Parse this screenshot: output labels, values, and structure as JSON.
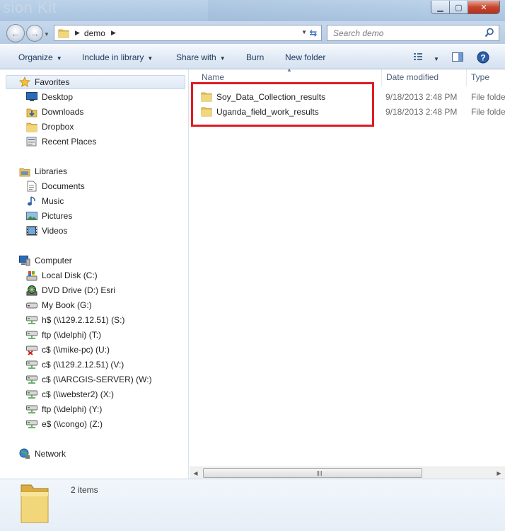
{
  "window": {
    "title_ghost": "sion Kit"
  },
  "address": {
    "path": [
      "demo"
    ],
    "search_placeholder": "Search demo"
  },
  "toolbar": {
    "organize": "Organize",
    "include_in_library": "Include in library",
    "share_with": "Share with",
    "burn": "Burn",
    "new_folder": "New folder"
  },
  "nav": {
    "favorites": "Favorites",
    "desktop": "Desktop",
    "downloads": "Downloads",
    "dropbox": "Dropbox",
    "recent_places": "Recent Places",
    "libraries": "Libraries",
    "documents": "Documents",
    "music": "Music",
    "pictures": "Pictures",
    "videos": "Videos",
    "computer": "Computer",
    "drives": [
      "Local Disk (C:)",
      "DVD Drive (D:) Esri",
      "My Book (G:)",
      "h$ (\\\\129.2.12.51) (S:)",
      "ftp (\\\\delphi) (T:)",
      "c$ (\\\\mike-pc) (U:)",
      "c$ (\\\\129.2.12.51) (V:)",
      "c$ (\\\\ARCGIS-SERVER) (W:)",
      "c$ (\\\\webster2) (X:)",
      "ftp (\\\\delphi) (Y:)",
      "e$ (\\\\congo) (Z:)"
    ],
    "network": "Network"
  },
  "columns": {
    "name": "Name",
    "date_modified": "Date modified",
    "type": "Type"
  },
  "files": [
    {
      "name": "Soy_Data_Collection_results",
      "date": "9/18/2013 2:48 PM",
      "type": "File folder"
    },
    {
      "name": "Uganda_field_work_results",
      "date": "9/18/2013 2:48 PM",
      "type": "File folder"
    }
  ],
  "details": {
    "item_count": "2 items"
  },
  "colors": {
    "highlight": "#e01b22",
    "folder": "#e8c458"
  }
}
